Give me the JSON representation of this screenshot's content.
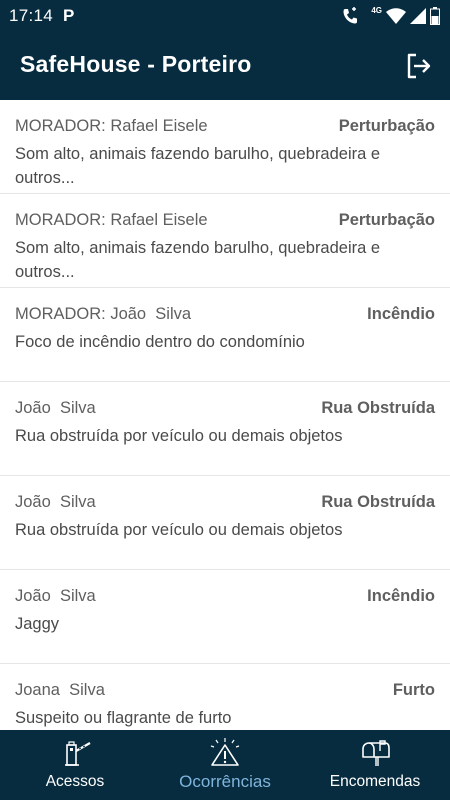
{
  "status_bar": {
    "time": "17:14",
    "notification_icon": "P",
    "network_label": "4G",
    "icons": [
      "call-icon",
      "wifi-icon",
      "signal-icon",
      "battery-icon"
    ]
  },
  "header": {
    "title": "SafeHouse - Porteiro",
    "logout_icon": "logout-icon"
  },
  "occurrences": [
    {
      "resident": "MORADOR: Rafael Eisele",
      "type": "Perturbação",
      "description": "Som alto, animais fazendo barulho, quebradeira e outros..."
    },
    {
      "resident": "MORADOR: Rafael Eisele",
      "type": "Perturbação",
      "description": "Som alto, animais fazendo barulho, quebradeira e outros..."
    },
    {
      "resident": "MORADOR: João  Silva",
      "type": "Incêndio",
      "description": "Foco de incêndio dentro do condomínio"
    },
    {
      "resident": "João  Silva",
      "type": "Rua Obstruída",
      "description": "Rua obstruída por veículo ou demais objetos"
    },
    {
      "resident": "João  Silva",
      "type": "Rua Obstruída",
      "description": "Rua obstruída por veículo ou demais objetos"
    },
    {
      "resident": "João  Silva",
      "type": "Incêndio",
      "description": "Jaggy"
    },
    {
      "resident": "Joana  Silva",
      "type": "Furto",
      "description": "Suspeito ou flagrante de furto"
    }
  ],
  "bottom_nav": {
    "items": [
      {
        "label": "Acessos",
        "icon": "gate-barrier-icon",
        "active": false
      },
      {
        "label": "Ocorrências",
        "icon": "warning-icon",
        "active": true
      },
      {
        "label": "Encomendas",
        "icon": "mailbox-icon",
        "active": false
      }
    ]
  },
  "colors": {
    "primary": "#072c3f",
    "active_tab": "#7fb4dc",
    "text_primary": "#5f5f5f",
    "divider": "#e6e6e6"
  }
}
